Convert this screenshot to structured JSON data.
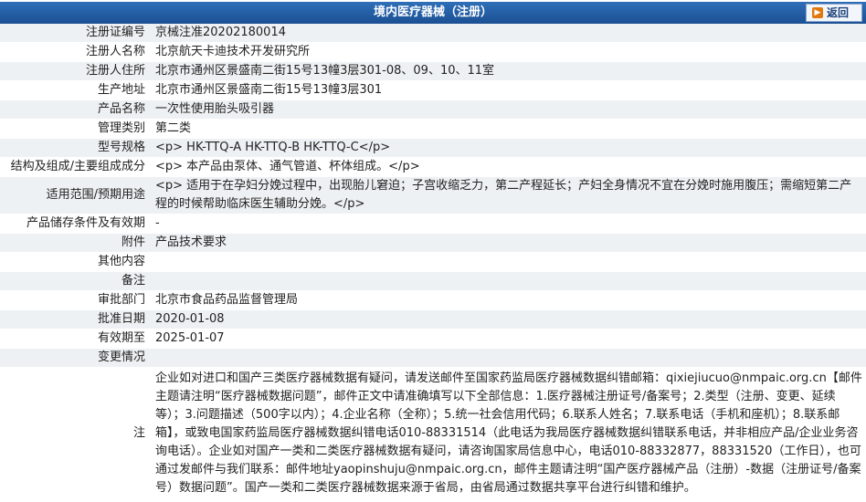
{
  "header": {
    "title": "境内医疗器械（注册）",
    "back_label": "返回"
  },
  "rows": [
    {
      "label": "注册证编号",
      "value": "京械注准20202180014"
    },
    {
      "label": "注册人名称",
      "value": "北京航天卡迪技术开发研究所"
    },
    {
      "label": "注册人住所",
      "value": "北京市通州区景盛南二街15号13幢3层301-08、09、10、11室"
    },
    {
      "label": "生产地址",
      "value": "北京市通州区景盛南二街15号13幢3层301"
    },
    {
      "label": "产品名称",
      "value": "一次性使用胎头吸引器"
    },
    {
      "label": "管理类别",
      "value": "第二类"
    },
    {
      "label": "型号规格",
      "value": "<p> HK-TTQ-A HK-TTQ-B HK-TTQ-C</p>"
    },
    {
      "label": "结构及组成/主要组成成分",
      "value": "<p> 本产品由泵体、通气管道、杯体组成。</p>"
    },
    {
      "label": "适用范围/预期用途",
      "value": "<p> 适用于在孕妇分娩过程中，出现胎儿窘迫；子宫收缩乏力，第二产程延长；产妇全身情况不宜在分娩时施用腹压；需缩短第二产程的时候帮助临床医生辅助分娩。</p>"
    },
    {
      "label": "产品储存条件及有效期",
      "value": "-"
    },
    {
      "label": "附件",
      "value": "产品技术要求"
    },
    {
      "label": "其他内容",
      "value": ""
    },
    {
      "label": "备注",
      "value": ""
    },
    {
      "label": "审批部门",
      "value": "北京市食品药品监督管理局"
    },
    {
      "label": "批准日期",
      "value": "2020-01-08"
    },
    {
      "label": "有效期至",
      "value": "2025-01-07"
    },
    {
      "label": "变更情况",
      "value": ""
    }
  ],
  "note": {
    "label": "注",
    "text": "企业如对进口和国产三类医疗器械数据有疑问，请发送邮件至国家药监局医疗器械数据纠错邮箱：qixiejiucuo@nmpaic.org.cn【邮件主题请注明“医疗器械数据问题”，邮件正文中请准确填写以下全部信息：1.医疗器械注册证号/备案号；2.类型（注册、变更、延续等）；3.问题描述（500字以内）；4.企业名称（全称）；5.统一社会信用代码；6.联系人姓名；7.联系电话（手机和座机）；8.联系邮箱】，或致电国家药监局医疗器械数据纠错电话010-88331514（此电话为我局医疗器械数据纠错联系电话，并非相应产品/企业业务咨询电话）。企业如对国产一类和二类医疗器械数据有疑问，请咨询国家局信息中心，电话010-88332877，88331520（工作日），也可通过发邮件与我们联系：邮件地址yaopinshuju@nmpaic.org.cn，邮件主题请注明“国产医疗器械产品（注册）-数据（注册证号/备案号）数据问题”。国产一类和二类医疗器械数据来源于省局，由省局通过数据共享平台进行纠错和维护。"
  }
}
